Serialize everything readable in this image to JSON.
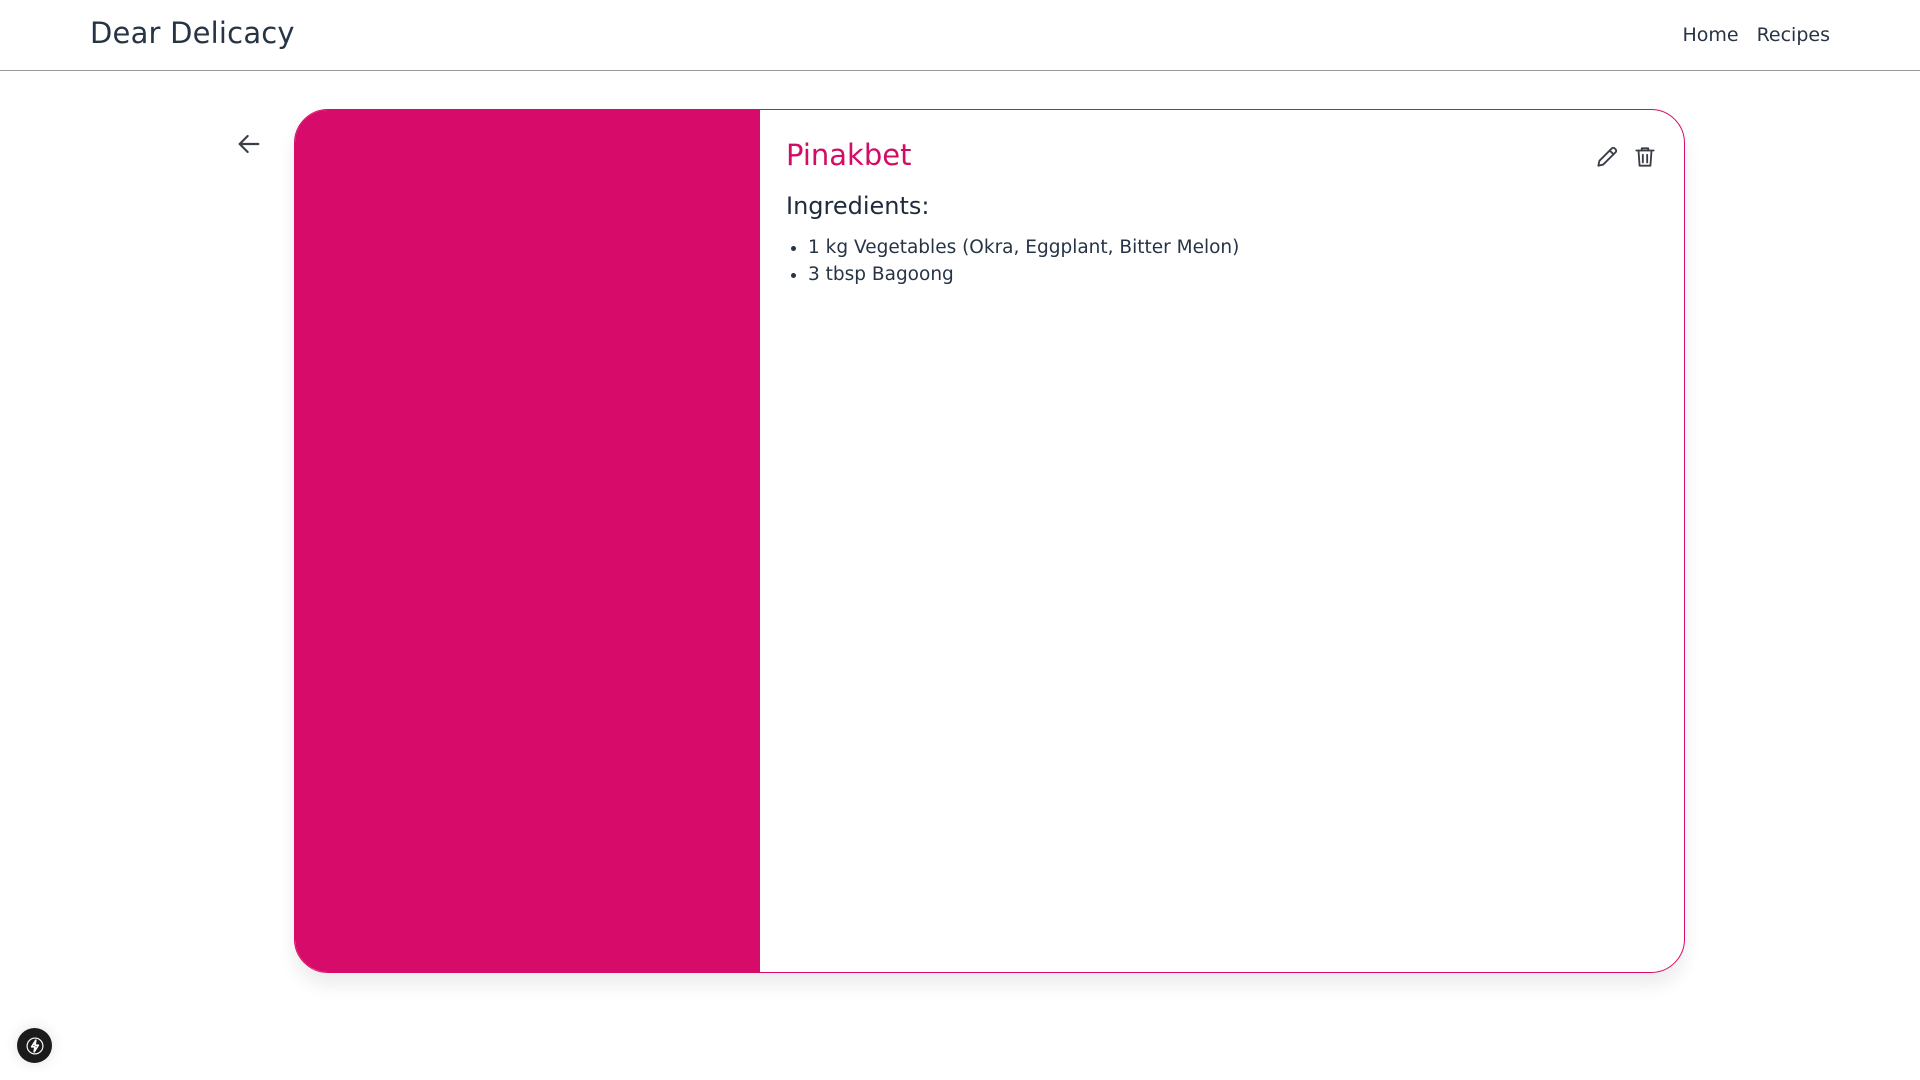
{
  "navbar": {
    "brand": "Dear Delicacy",
    "links": [
      {
        "label": "Home"
      },
      {
        "label": "Recipes"
      }
    ]
  },
  "recipe": {
    "title": "Pinakbet",
    "ingredients_heading": "Ingredients:",
    "ingredients": [
      "1 kg Vegetables (Okra, Eggplant, Bitter Melon)",
      "3 tbsp Bagoong"
    ]
  },
  "icons": {
    "back": "arrow-left-icon",
    "edit": "pencil-icon",
    "delete": "trash-icon",
    "dev_badge": "lightning-icon"
  },
  "colors": {
    "accent": "#d70b69",
    "text": "#263445",
    "divider": "#9a9a9a"
  }
}
